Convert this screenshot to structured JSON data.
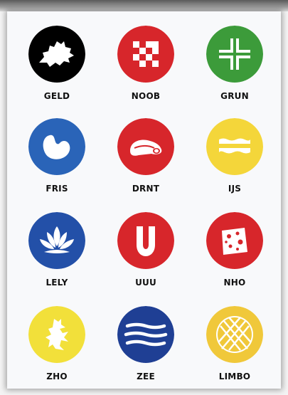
{
  "icons": [
    {
      "label": "GELD",
      "icon": "map-silhouette-icon",
      "color": "#000000"
    },
    {
      "label": "NOOB",
      "icon": "checkerboard-icon",
      "color": "#d7262b"
    },
    {
      "label": "GRUN",
      "icon": "double-cross-icon",
      "color": "#3c9b3a"
    },
    {
      "label": "FRIS",
      "icon": "bean-icon",
      "color": "#2a64b8"
    },
    {
      "label": "DRNT",
      "icon": "cap-icon",
      "color": "#d7262b"
    },
    {
      "label": "IJS",
      "icon": "ice-waves-icon",
      "color": "#f4d63a"
    },
    {
      "label": "LELY",
      "icon": "lotus-icon",
      "color": "#2350a8"
    },
    {
      "label": "UUU",
      "icon": "letter-u-icon",
      "color": "#d7262b"
    },
    {
      "label": "NHO",
      "icon": "cheese-icon",
      "color": "#d7262b"
    },
    {
      "label": "ZHO",
      "icon": "lion-icon",
      "color": "#f2e03a"
    },
    {
      "label": "ZEE",
      "icon": "sea-waves-icon",
      "color": "#1f3f94"
    },
    {
      "label": "LIMBO",
      "icon": "lattice-pie-icon",
      "color": "#f0c83a"
    }
  ]
}
